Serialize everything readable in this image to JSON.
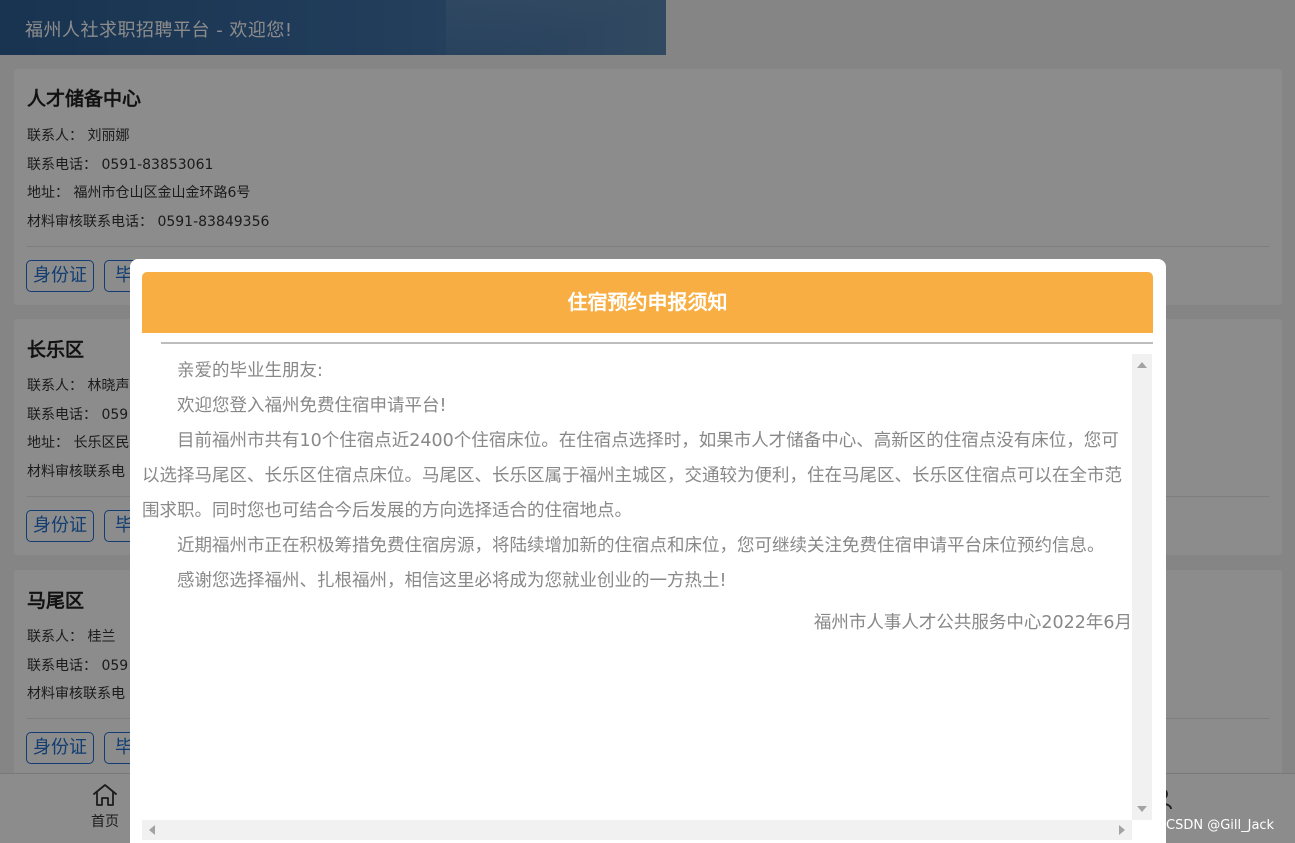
{
  "header": {
    "title": "福州人社求职招聘平台 - 欢迎您!"
  },
  "cards": [
    {
      "title": "人才储备中心",
      "rows": [
        {
          "label": "联系人：",
          "value": "刘丽娜"
        },
        {
          "label": "联系电话：",
          "value": "0591-83853061"
        },
        {
          "label": "地址：",
          "value": "福州市仓山区金山金环路6号"
        },
        {
          "label": "材料审核联系电话：",
          "value": "0591-83849356"
        }
      ],
      "tags": [
        "身份证",
        "毕"
      ]
    },
    {
      "title": "长乐区",
      "rows": [
        {
          "label": "联系人：",
          "value": "林晓声"
        },
        {
          "label": "联系电话：",
          "value": "059"
        },
        {
          "label": "地址：",
          "value": "长乐区民"
        },
        {
          "label": "材料审核联系电",
          "value": ""
        }
      ],
      "tags": [
        "身份证",
        "毕"
      ]
    },
    {
      "title": "马尾区",
      "rows": [
        {
          "label": "联系人：",
          "value": "桂兰"
        },
        {
          "label": "联系电话：",
          "value": "059"
        },
        {
          "label": "材料审核联系电",
          "value": ""
        }
      ],
      "tags": [
        "身份证",
        "毕"
      ]
    }
  ],
  "bottom_nav": {
    "home_label": "首页"
  },
  "modal": {
    "title": "住宿预约申报须知",
    "greeting": "亲爱的毕业生朋友:",
    "p1": "欢迎您登入福州免费住宿申请平台!",
    "p2": "目前福州市共有10个住宿点近2400个住宿床位。在住宿点选择时，如果市人才储备中心、高新区的住宿点没有床位，您可以选择马尾区、长乐区住宿点床位。马尾区、长乐区属于福州主城区，交通较为便利，住在马尾区、长乐区住宿点可以在全市范围求职。同时您也可结合今后发展的方向选择适合的住宿地点。",
    "p3": "近期福州市正在积极筹措免费住宿房源，将陆续增加新的住宿点和床位，您可继续关注免费住宿申请平台床位预约信息。",
    "p4": "感谢您选择福州、扎根福州，相信这里必将成为您就业创业的一方热土!",
    "signature": "福州市人事人才公共服务中心2022年6月",
    "header_color": "#f8ae42"
  },
  "watermark": "CSDN @Gill_Jack"
}
